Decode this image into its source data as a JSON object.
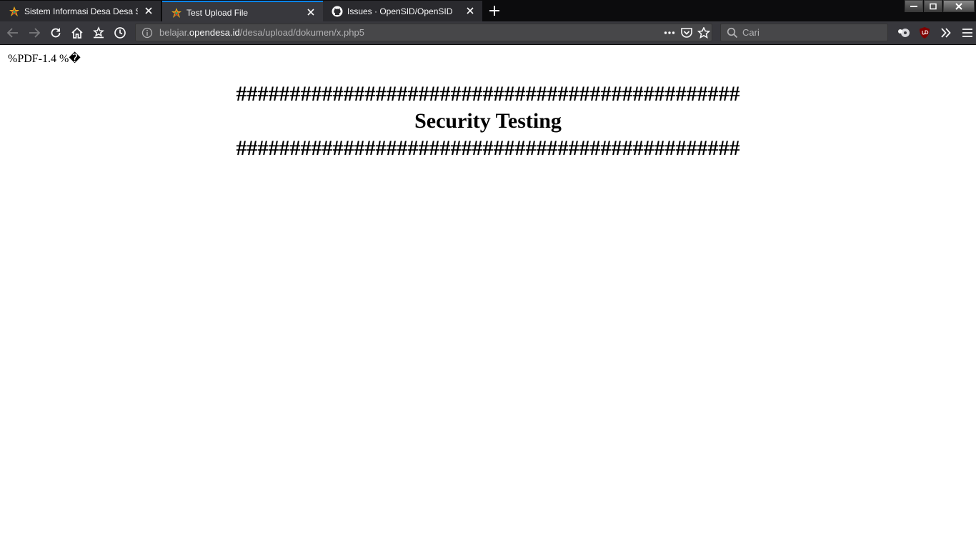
{
  "browser": {
    "tabs": [
      {
        "title": "Sistem Informasi Desa Desa Senggig",
        "favicon": "opensid-logo-icon",
        "active": false
      },
      {
        "title": "Test Upload File",
        "favicon": "opensid-logo-icon",
        "active": true
      },
      {
        "title": "Issues · OpenSID/OpenSID",
        "favicon": "github-icon",
        "active": false
      }
    ],
    "url": {
      "prefix": "belajar.",
      "host": "opendesa.id",
      "path": "/desa/upload/dokumen/x.php5"
    },
    "search_placeholder": "Cari",
    "accent_color": "#0a84ff"
  },
  "page": {
    "pdf_header": "%PDF-1.4 %�",
    "hash_line_top": "###############################################",
    "heading": "Security Testing",
    "hash_line_bottom": "###############################################"
  }
}
